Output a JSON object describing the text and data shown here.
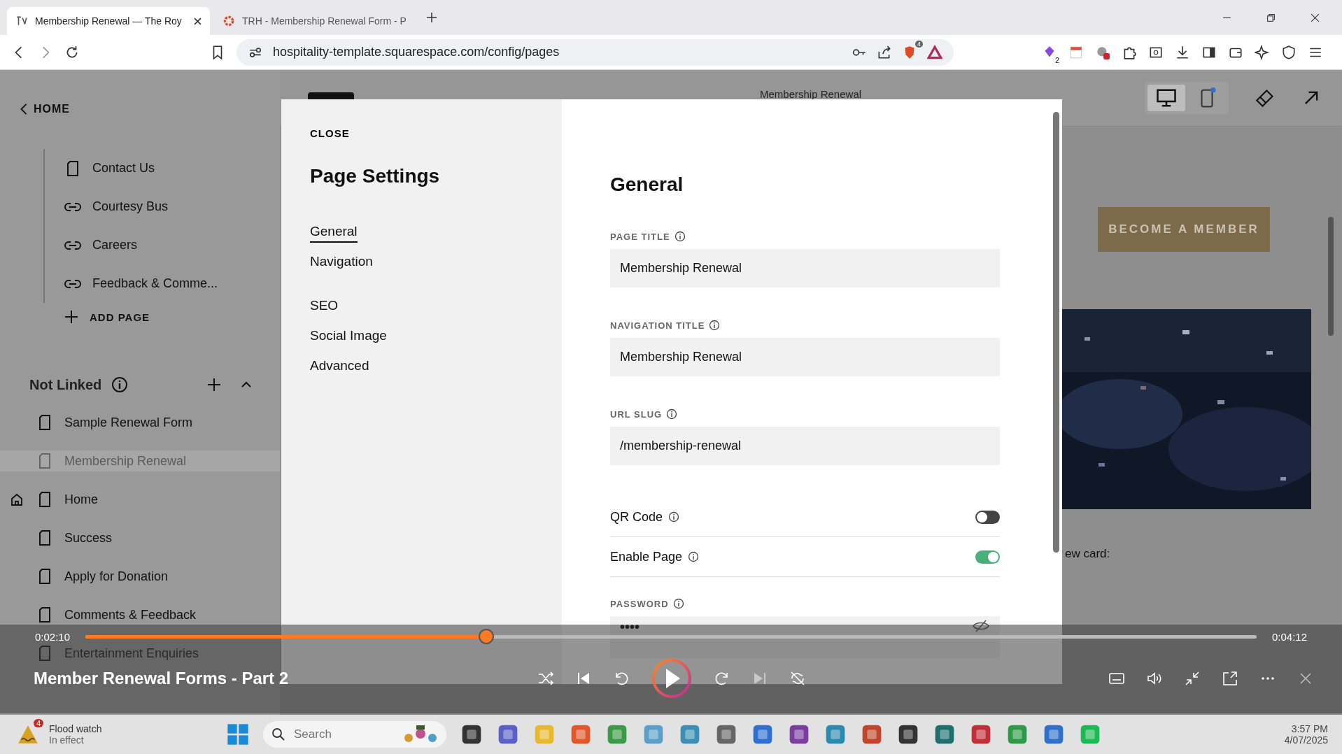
{
  "browser": {
    "tabs": [
      {
        "title": "Membership Renewal — The Roy",
        "selected": true
      },
      {
        "title": "TRH - Membership Renewal Form - P",
        "selected": false
      }
    ],
    "url": "hospitality-template.squarespace.com/config/pages",
    "shield_badge": "4",
    "extension_badge": "2"
  },
  "sidebar": {
    "back_label": "HOME",
    "tree": [
      {
        "label": "Contact Us",
        "kind": "page"
      },
      {
        "label": "Courtesy Bus",
        "kind": "link"
      },
      {
        "label": "Careers",
        "kind": "link"
      },
      {
        "label": "Feedback & Comme...",
        "kind": "link"
      }
    ],
    "add_page": "ADD PAGE",
    "not_linked": {
      "title": "Not Linked",
      "items": [
        {
          "label": "Sample Renewal Form",
          "selected": false,
          "home": false
        },
        {
          "label": "Membership Renewal",
          "selected": true,
          "home": false
        },
        {
          "label": "Home",
          "selected": false,
          "home": true
        },
        {
          "label": "Success",
          "selected": false,
          "home": false
        },
        {
          "label": "Apply for Donation",
          "selected": false,
          "home": false
        },
        {
          "label": "Comments & Feedback",
          "selected": false,
          "home": false
        },
        {
          "label": "Entertainment Enquiries",
          "selected": false,
          "home": false
        }
      ]
    }
  },
  "preview": {
    "page_title": "Membership Renewal",
    "devices": [
      {
        "kind": "desktop",
        "selected": true
      },
      {
        "kind": "mobile",
        "selected": false
      }
    ],
    "cta": "BECOME A MEMBER",
    "caption": "ew card:"
  },
  "modal": {
    "close_label": "CLOSE",
    "title": "Page Settings",
    "nav_groups": [
      [
        {
          "label": "General",
          "selected": true
        },
        {
          "label": "Navigation",
          "selected": false
        }
      ],
      [
        {
          "label": "SEO",
          "selected": false
        },
        {
          "label": "Social Image",
          "selected": false
        },
        {
          "label": "Advanced",
          "selected": false
        }
      ]
    ],
    "section_title": "General",
    "fields": [
      {
        "label": "PAGE TITLE",
        "value": "Membership Renewal"
      },
      {
        "label": "NAVIGATION TITLE",
        "value": "Membership Renewal"
      },
      {
        "label": "URL SLUG",
        "value": "/membership-renewal"
      }
    ],
    "toggles": [
      {
        "label": "QR Code",
        "on": false
      },
      {
        "label": "Enable Page",
        "on": true
      }
    ],
    "password": {
      "label": "PASSWORD",
      "value": "••••"
    }
  },
  "player": {
    "elapsed": "0:02:10",
    "duration": "0:04:12",
    "level": 0.342,
    "title": "Member Renewal Forms - Part 2"
  },
  "taskbar": {
    "weather": {
      "badge": "4",
      "title": "Flood watch",
      "subtitle": "In effect"
    },
    "search_placeholder": "Search",
    "time": "3:57 PM",
    "date": "4/07/2025"
  }
}
